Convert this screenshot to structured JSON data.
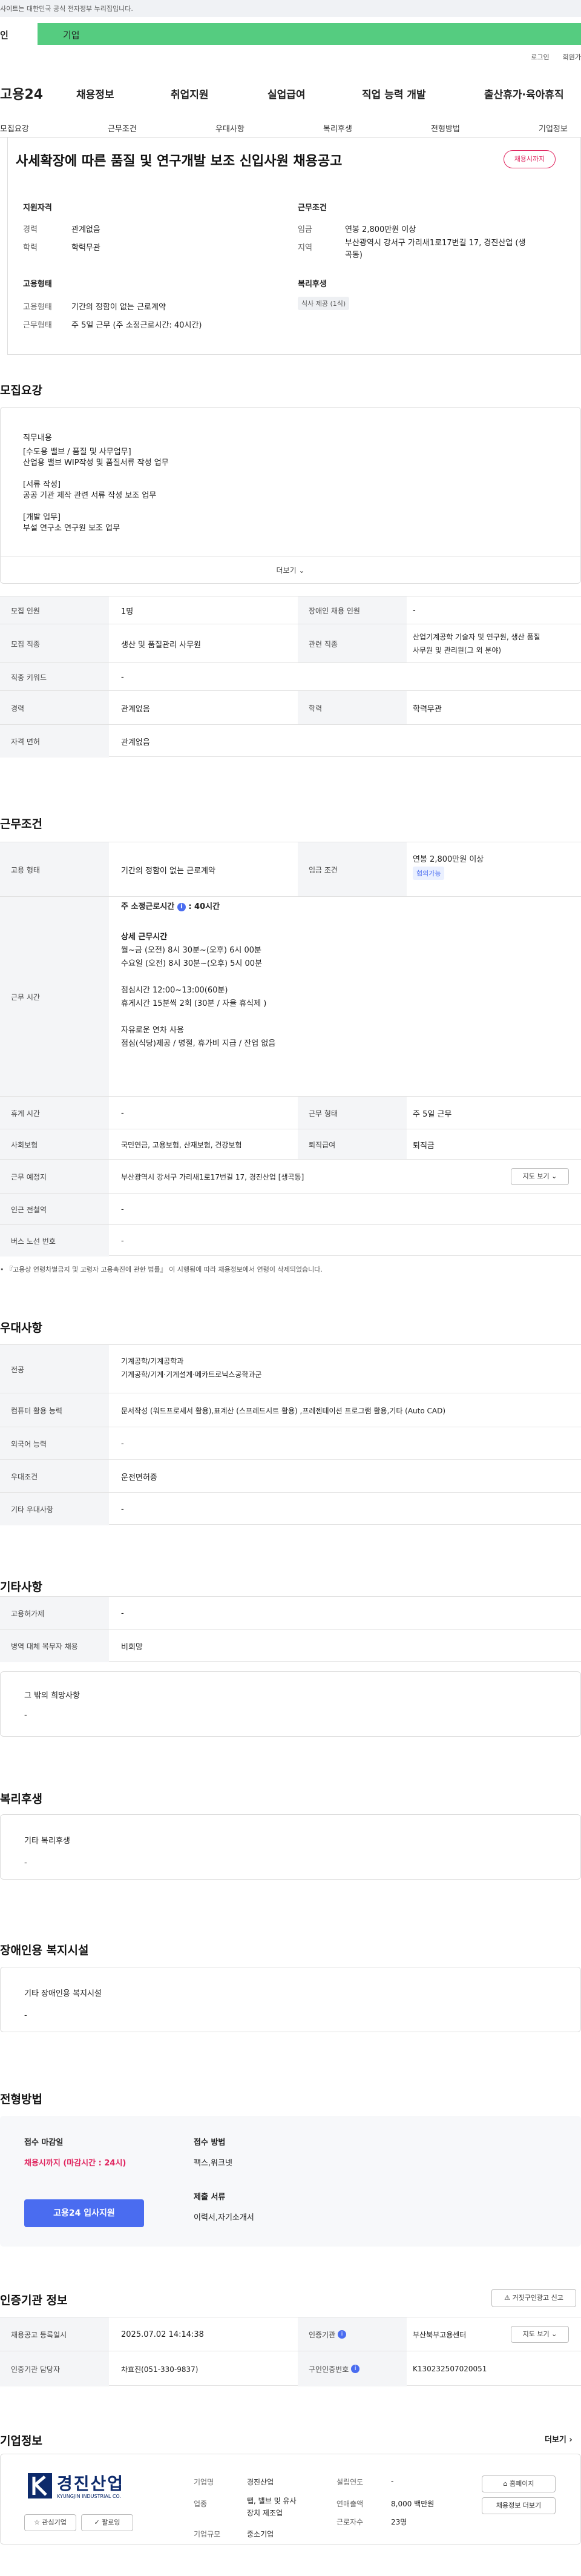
{
  "topbar": {
    "notice": "사이트는 대한민국 공식 전자정부 누리집입니다."
  },
  "tabs": {
    "selected": "인",
    "second": "기업"
  },
  "utility": {
    "login": "로그인",
    "signup": "회원가"
  },
  "gnb": {
    "logo": "고용24",
    "items": [
      "채용정보",
      "취업지원",
      "실업급여",
      "직업 능력 개발",
      "출산휴가·육아휴직"
    ]
  },
  "subnav": [
    "모집요강",
    "근무조건",
    "우대사항",
    "복리후생",
    "전형방법",
    "기업정보"
  ],
  "header": {
    "title": "사세확장에 따른 품질 및 연구개발 보조 신입사원 채용공고",
    "badge": "채용시까지"
  },
  "summary": {
    "applicant_title": "지원자격",
    "career_label": "경력",
    "career": "관계없음",
    "edu_label": "학력",
    "edu": "학력무관",
    "employ_title": "고용형태",
    "employ_type_label": "고용형태",
    "employ_type": "기간의 정함이 없는 근로계약",
    "work_type_label": "근무형태",
    "work_type": "주 5일 근무 (주 소정근로시간: 40시간)",
    "cond_title": "근무조건",
    "wage_label": "임금",
    "wage": "연봉 2,800만원 이상",
    "region_label": "지역",
    "region_l1": "부산광역시 강서구 가리새1로17번길 17, 경진산업 (생",
    "region_l2": "곡동)",
    "welfare_title": "복리후생",
    "welfare_tag": "식사 제공 (1식)"
  },
  "recruit": {
    "title": "모집요강",
    "duty_title": "직무내용",
    "duty_lines": [
      "[수도용 밸브 / 품질 및 사무업무]",
      "산업용 밸브 WIP작성 및 품질서류 작성 업무",
      "",
      "[서류 작성]",
      "공공 기관 제작 관련 서류 작성 보조 업무",
      "",
      "[개발 업무]",
      "부설 연구소 연구원 보조 업무"
    ],
    "more": "더보기",
    "rows": [
      {
        "k1": "모집 인원",
        "v1": "1명",
        "k2": "장애인 채용 인원",
        "v2": "-"
      },
      {
        "k1": "모집 직종",
        "v1": "생산 및 품질관리 사무원",
        "k2": "관련 직종",
        "v2a": "산업기계공학 기술자 및 연구원, 생산 품질",
        "v2b": "사무원 및 관리원(그 외 분야)"
      },
      {
        "k1": "직종 키워드",
        "v1": "-"
      },
      {
        "k1": "경력",
        "v1": "관계없음",
        "k2": "학력",
        "v2": "학력무관"
      },
      {
        "k1": "자격 면허",
        "v1": "관계없음"
      }
    ]
  },
  "work": {
    "title": "근무조건",
    "employ_label": "고용 형태",
    "employ": "기간의 정함이 없는 근로계약",
    "wage_label": "임금 조건",
    "wage": "연봉 2,800만원 이상",
    "wage_tag": "협의가능",
    "hours_label": "근무 시간",
    "weekly": "주 소정근로시간",
    "weekly_val": ": 40시간",
    "detail_title": "상세 근무시간",
    "detail_lines": [
      "월~금 (오전) 8시 30분~(오후) 6시 00분",
      "수요일 (오전) 8시 30분~(오후) 5시 00분"
    ],
    "break_lines": [
      "점심시간 12:00~13:00(60분)",
      "휴게시간 15분씩 2회 (30분 / 자율 휴식제 )"
    ],
    "extra_lines": [
      "자유로운 연차 사용",
      "점심(식당)제공 / 명절, 휴가비 지급 / 잔업 없음"
    ],
    "rest_label": "휴게 시간",
    "rest": "-",
    "type_label": "근무 형태",
    "type": "주 5일 근무",
    "ins_label": "사회보험",
    "ins": "국민연금, 고용보험, 산재보험, 건강보험",
    "ret_label": "퇴직급여",
    "ret": "퇴직금",
    "place_label": "근무 예정지",
    "place": "부산광역시 강서구 가리새1로17번길 17, 경진산업 [생곡동]",
    "map_btn": "지도 보기",
    "station_label": "인근 전철역",
    "station": "-",
    "bus_label": "버스 노선 번호",
    "bus": "-",
    "note": "『고용상 연령차별금지 및 고령자 고용촉진에 관한 법률』 이 시행됨에 따라 채용정보에서 연령이 삭제되었습니다."
  },
  "pref": {
    "title": "우대사항",
    "rows": [
      {
        "k": "전공",
        "v": [
          "기계공학/기계공학과",
          "기계공학/기계·기계설계·메카트로닉스공학과군"
        ]
      },
      {
        "k": "컴퓨터 활용 능력",
        "v": [
          "문서작성 (워드프로세서 활용),표계산 (스프레드시트 활용) ,프레젠테이션 프로그램 활용,기타 (Auto CAD)"
        ]
      },
      {
        "k": "외국어 능력",
        "v": [
          "-"
        ]
      },
      {
        "k": "우대조건",
        "v": [
          "운전면허증"
        ]
      },
      {
        "k": "기타 우대사항",
        "v": [
          "-"
        ]
      }
    ]
  },
  "etc": {
    "title": "기타사항",
    "rows": [
      {
        "k": "고용허가제",
        "v": "-"
      },
      {
        "k": "병역 대체 복무자 채용",
        "v": "비희망"
      }
    ],
    "other_title": "그 밖의 희망사항",
    "other": "-"
  },
  "welfare": {
    "title": "복리후생",
    "sub": "기타 복리후생",
    "val": "-"
  },
  "disabled": {
    "title": "장애인용 복지시설",
    "sub": "기타 장애인용 복지시설",
    "val": "-"
  },
  "process": {
    "title": "전형방법",
    "deadline_title": "접수 마감일",
    "deadline": "채용시까지 (마감시간 : 24시)",
    "method_title": "접수 방법",
    "method": "팩스,워크넷",
    "docs_title": "제출 서류",
    "docs": "이력서,자기소개서",
    "apply_btn": "고용24 입사지원"
  },
  "manager": {
    "title": "인증기관 정보",
    "report_btn": "거짓구인광고 신고",
    "reg_date_label": "채용공고 등록일시",
    "reg_date": "2025.07.02 14:14:38",
    "org_label": "인증기관",
    "org": "부산북부고용센터",
    "map_btn": "지도 보기",
    "contact_label": "인증기관 담당자",
    "contact": "차효진(051-330-9837)",
    "jobno_label": "구인인증번호",
    "jobno": "K130232507020051"
  },
  "company": {
    "title": "기업정보",
    "more": "더보기",
    "logo_kr": "경진산업",
    "logo_en": "KYUNGJIN INDUSTRIAL CO.",
    "fav_btn": "관심기업",
    "follow_btn": "팔로잉",
    "name_label": "기업명",
    "name": "경진산업",
    "biz_label": "업종",
    "biz_l1": "탭, 밸브 및 유사",
    "biz_l2": "장치 제조업",
    "size_label": "기업규모",
    "size": "중소기업",
    "found_label": "설립연도",
    "found": "-",
    "sales_label": "연매출액",
    "sales": "8,000 백만원",
    "emp_label": "근로자수",
    "emp": "23명",
    "home_btn": "홈페이지",
    "list_btn": "채용정보 더보기"
  }
}
